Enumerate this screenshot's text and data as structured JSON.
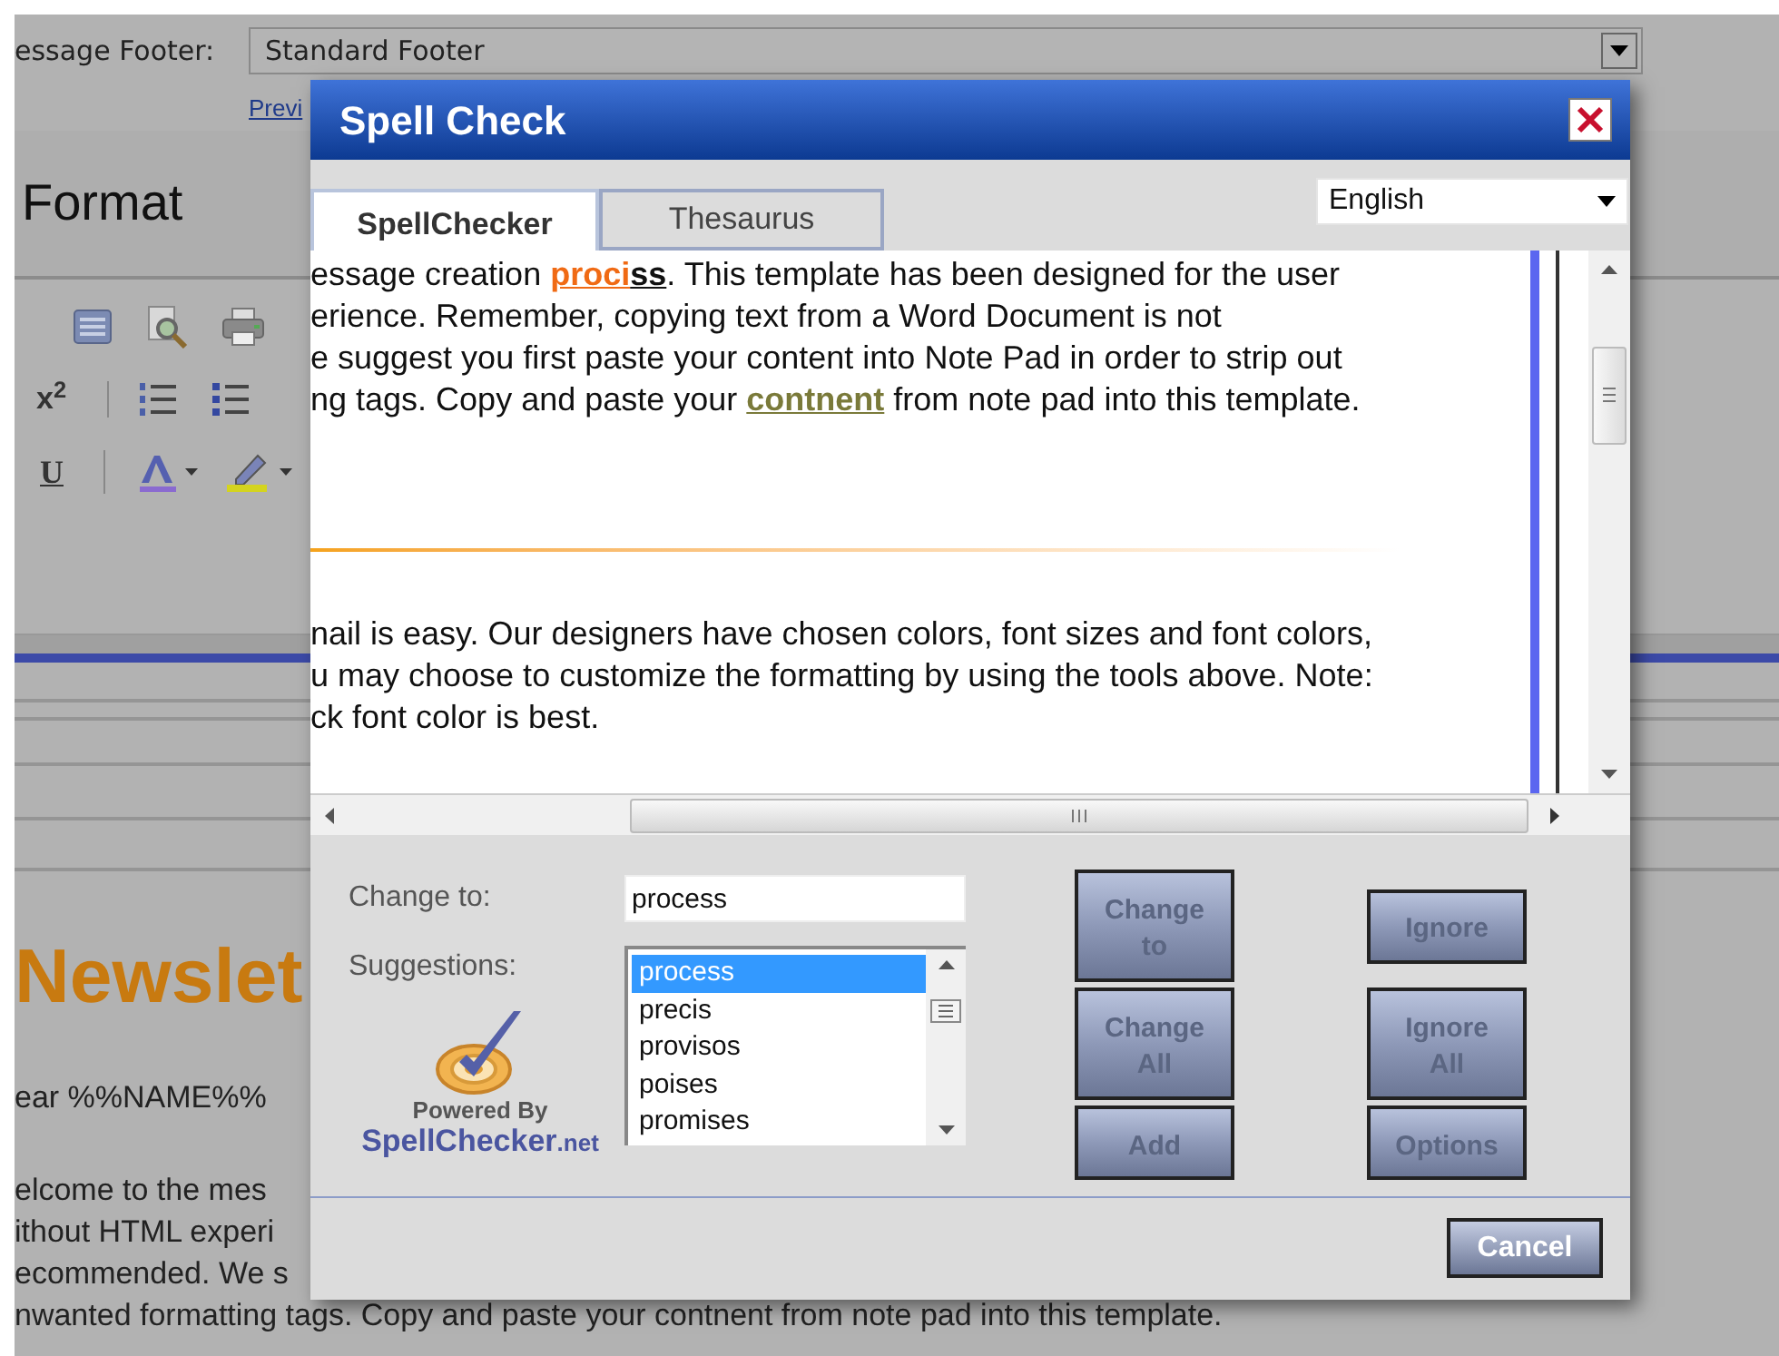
{
  "background": {
    "footer_label": "essage Footer:",
    "footer_select": "Standard Footer",
    "preview_link": "Previ",
    "section_title": "Format",
    "superscript_label": "x$^{2}$",
    "underline_label": "U",
    "newsletter_heading": "Newslet",
    "greeting": "ear %%NAME%%",
    "body_lines": [
      "elcome to the mes",
      "ithout HTML experi",
      "ecommended. We s",
      "nwanted formatting tags. Copy and paste your contnent from note pad into this template."
    ]
  },
  "dialog": {
    "title": "Spell Check",
    "tabs": [
      {
        "label": "SpellChecker",
        "selected": true
      },
      {
        "label": "Thesaurus",
        "selected": false
      }
    ],
    "language": "English",
    "document": {
      "paragraphs": [
        [
          [
            {
              "text": "essage creation ",
              "kind": "plain"
            },
            {
              "text": "proci",
              "kind": "current"
            },
            {
              "text": "ss",
              "kind": "current_tail"
            },
            {
              "text": ". This template has been designed for the user",
              "kind": "plain"
            }
          ],
          [
            {
              "text": "erience. Remember, copying text from a Word Document is not",
              "kind": "plain"
            }
          ],
          [
            {
              "text": "e suggest you first paste your content into Note Pad in order to strip out",
              "kind": "plain"
            }
          ],
          [
            {
              "text": "ng tags. Copy and paste your ",
              "kind": "plain"
            },
            {
              "text": "contnent",
              "kind": "flagged"
            },
            {
              "text": " from note pad into this template.",
              "kind": "plain"
            }
          ]
        ],
        [
          [
            {
              "text": "nail is easy. Our designers have chosen colors, font sizes and font colors,",
              "kind": "plain"
            }
          ],
          [
            {
              "text": "u may choose to customize the formatting by using the tools above. Note:",
              "kind": "plain"
            }
          ],
          [
            {
              "text": "ck font color is best.",
              "kind": "plain"
            }
          ]
        ]
      ]
    },
    "change_to": {
      "label": "Change to:",
      "value": "process"
    },
    "suggestions": {
      "label": "Suggestions:",
      "items": [
        {
          "text": "process",
          "selected": true
        },
        {
          "text": "precis",
          "selected": false
        },
        {
          "text": "provisos",
          "selected": false
        },
        {
          "text": "poises",
          "selected": false
        },
        {
          "text": "promises",
          "selected": false
        }
      ]
    },
    "logo": {
      "tagline": "Powered By",
      "brand": "SpellChecker",
      "brand_suffix": ".net"
    },
    "buttons": [
      {
        "label": "Change to",
        "kind": "double"
      },
      {
        "label": "Ignore",
        "kind": "single"
      },
      {
        "label": "Change All",
        "kind": "double"
      },
      {
        "label": "Ignore All",
        "kind": "double"
      },
      {
        "label": "Add",
        "kind": "single"
      },
      {
        "label": "Options",
        "kind": "single"
      }
    ],
    "cancel": "Cancel"
  }
}
